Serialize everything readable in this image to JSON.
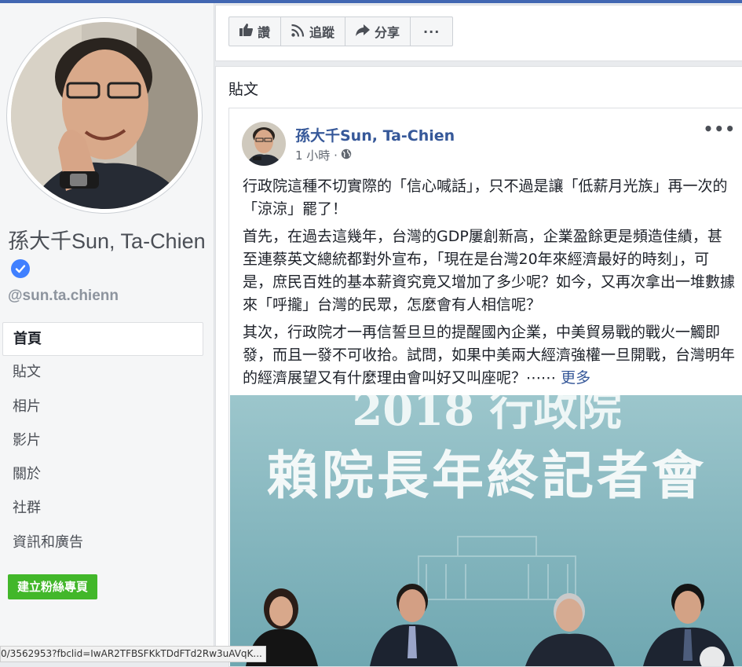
{
  "page": {
    "name": "孫大千Sun, Ta-Chien",
    "handle": "@sun.ta.chienn",
    "verified": true
  },
  "nav": {
    "items": [
      {
        "label": "首頁",
        "active": true
      },
      {
        "label": "貼文",
        "active": false
      },
      {
        "label": "相片",
        "active": false
      },
      {
        "label": "影片",
        "active": false
      },
      {
        "label": "關於",
        "active": false
      },
      {
        "label": "社群",
        "active": false
      },
      {
        "label": "資訊和廣告",
        "active": false
      }
    ],
    "create_page_label": "建立粉絲專頁"
  },
  "actions": {
    "like_label": "讚",
    "follow_label": "追蹤",
    "share_label": "分享",
    "more_label": "···"
  },
  "posts_section": {
    "heading": "貼文"
  },
  "post": {
    "author": "孫大千Sun, Ta-Chien",
    "time": "1 小時 ·",
    "more_label": "•••",
    "paragraphs": [
      "行政院這種不切實際的「信心喊話」，只不過是讓「低薪月光族」再一次的「涼涼」罷了！",
      "首先，在過去這幾年，台灣的GDP屢創新高，企業盈餘更是頻造佳績，甚至連蔡英文總統都對外宣布，「現在是台灣20年來經濟最好的時刻」，可是，庶民百姓的基本薪資究竟又增加了多少呢？如今，又再次拿出一堆數據來「呼攏」台灣的民眾，怎麼會有人相信呢？",
      "其次，行政院才一再信誓旦旦的提醒國內企業，中美貿易戰的戰火一觸即發，而且一發不可收拾。試問，如果中美兩大經濟強權一旦開戰，台灣明年的經濟展望又有什麼理由會叫好又叫座呢？⋯⋯"
    ],
    "see_more": "更多",
    "image": {
      "banner_line1": "2018  行政院",
      "banner_line2": "賴院長年終記者會"
    }
  },
  "status_bar": {
    "url": "0/3562953?fbclid=IwAR2TFBSFKkTDdFTd2Rw3uAVqK..."
  },
  "colors": {
    "facebook_blue": "#4267b2",
    "link": "#365899",
    "verified_badge": "#4080ff",
    "create_button": "#42b72a"
  }
}
